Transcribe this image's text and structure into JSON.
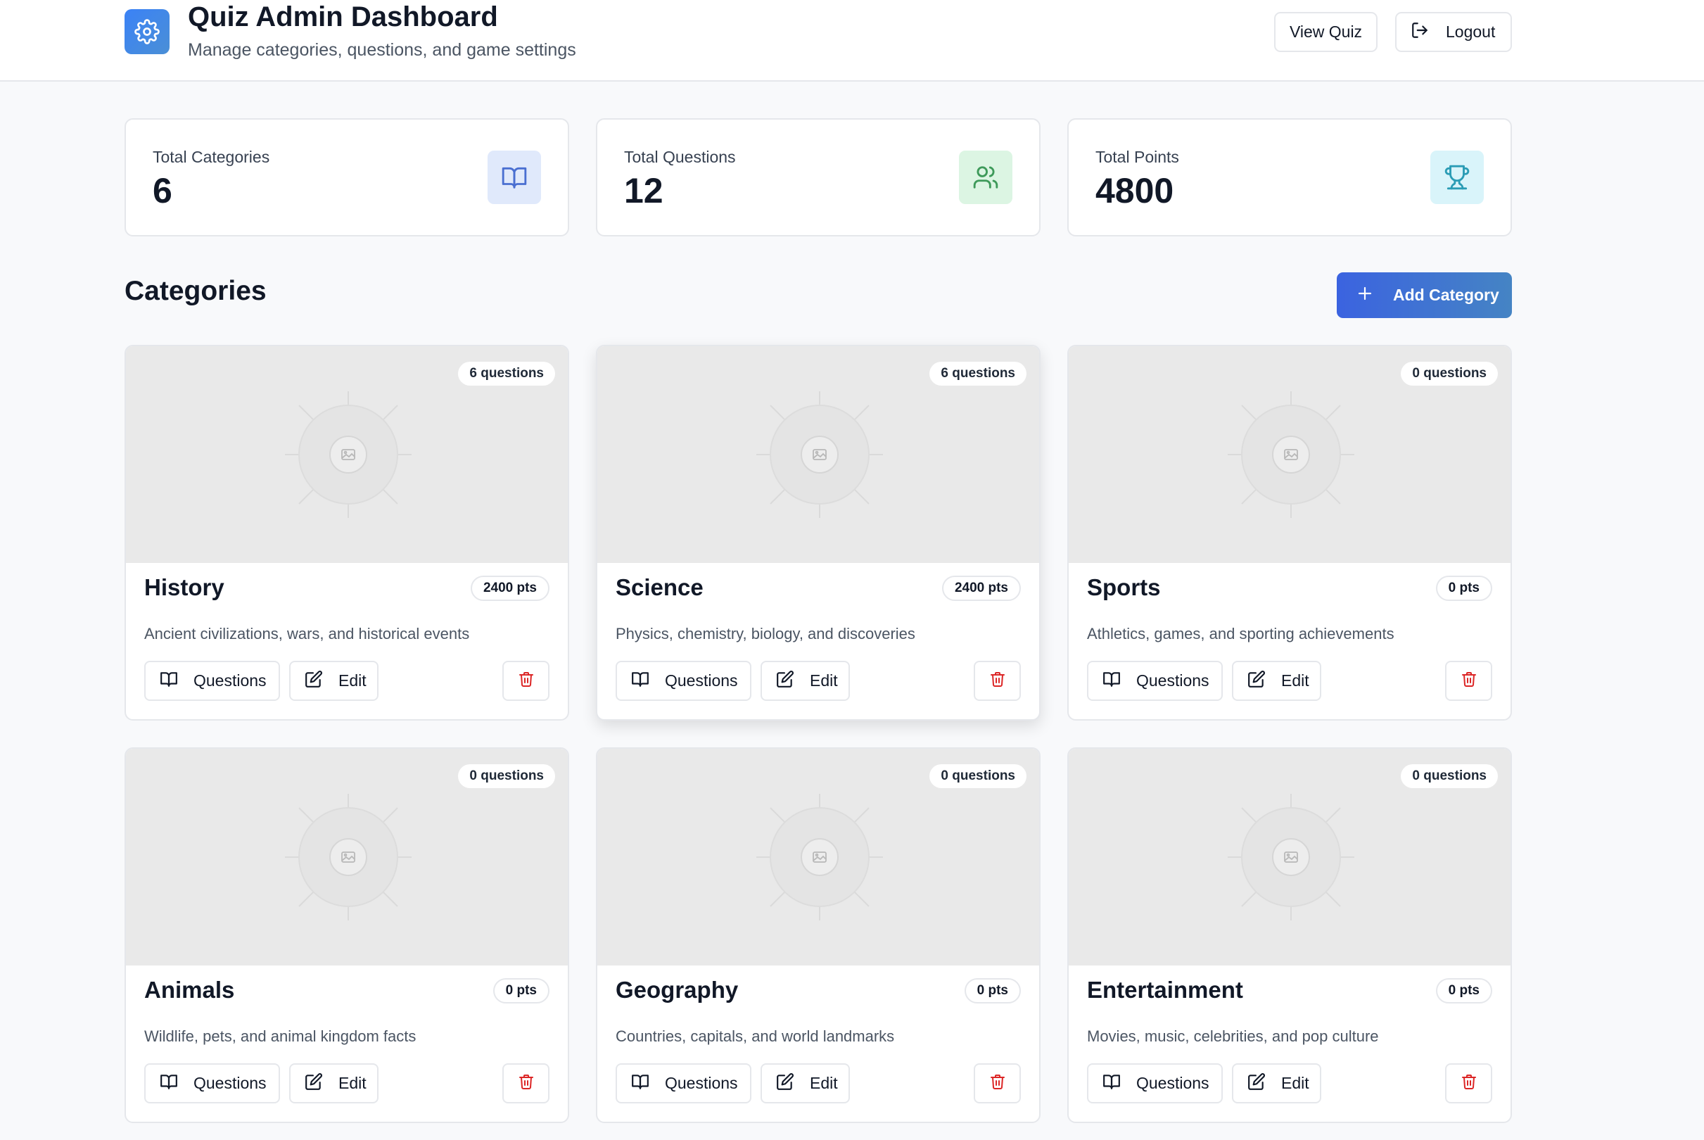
{
  "header": {
    "title": "Quiz Admin Dashboard",
    "subtitle": "Manage categories, questions, and game settings",
    "view_quiz_label": "View Quiz",
    "logout_label": "Logout",
    "logo_icon": "gear-icon"
  },
  "stats": [
    {
      "label": "Total Categories",
      "value": "6",
      "icon": "book-open-icon",
      "icon_bg": "#e0e9fb",
      "icon_color": "#4a6fd1"
    },
    {
      "label": "Total Questions",
      "value": "12",
      "icon": "users-icon",
      "icon_bg": "#dcf5e3",
      "icon_color": "#3e9a5a"
    },
    {
      "label": "Total Points",
      "value": "4800",
      "icon": "trophy-icon",
      "icon_bg": "#d9f4fa",
      "icon_color": "#2a9cb5"
    }
  ],
  "categories_section": {
    "title": "Categories",
    "add_label": "Add Category"
  },
  "card_actions": {
    "questions_label": "Questions",
    "edit_label": "Edit"
  },
  "categories": [
    {
      "name": "History",
      "description": "Ancient civilizations, wars, and historical events",
      "questions": "6 questions",
      "points": "2400 pts"
    },
    {
      "name": "Science",
      "description": "Physics, chemistry, biology, and discoveries",
      "questions": "6 questions",
      "points": "2400 pts"
    },
    {
      "name": "Sports",
      "description": "Athletics, games, and sporting achievements",
      "questions": "0 questions",
      "points": "0 pts"
    },
    {
      "name": "Animals",
      "description": "Wildlife, pets, and animal kingdom facts",
      "questions": "0 questions",
      "points": "0 pts"
    },
    {
      "name": "Geography",
      "description": "Countries, capitals, and world landmarks",
      "questions": "0 questions",
      "points": "0 pts"
    },
    {
      "name": "Entertainment",
      "description": "Movies, music, celebrities, and pop culture",
      "questions": "0 questions",
      "points": "0 pts"
    }
  ],
  "colors": {
    "accent_gradient_start": "#3b63e0",
    "accent_gradient_end": "#4584c4",
    "delete_red": "#dc2626"
  }
}
